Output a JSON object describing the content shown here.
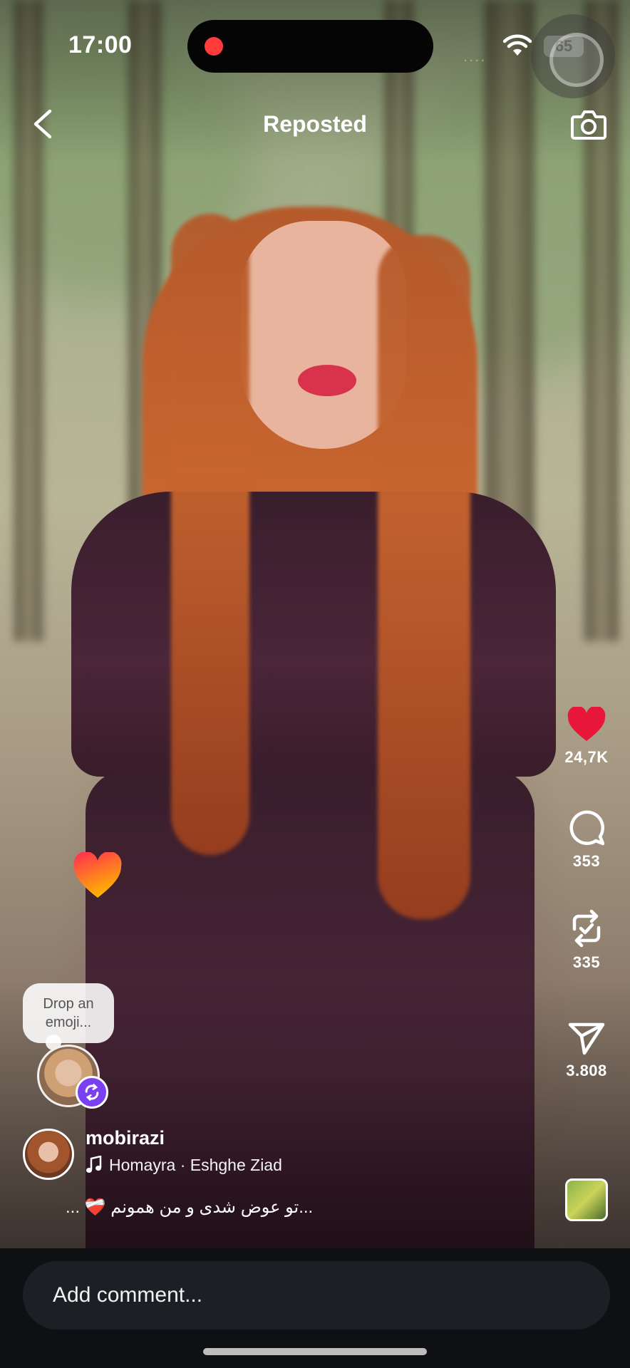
{
  "status_bar": {
    "time": "17:00",
    "battery_level": "65",
    "signal": "....",
    "wifi_icon": "wifi-icon",
    "recording_indicator_color": "#ff3b3b"
  },
  "header": {
    "title": "Reposted",
    "back_icon": "chevron-left-icon",
    "camera_icon": "camera-icon"
  },
  "actions": {
    "like": {
      "icon": "heart-icon",
      "count": "24,7K",
      "active": true,
      "color": "#e8173a"
    },
    "comment": {
      "icon": "comment-icon",
      "count": "353"
    },
    "repost": {
      "icon": "repost-icon",
      "count": "335"
    },
    "share": {
      "icon": "send-icon",
      "count": "3.808"
    },
    "more": {
      "icon": "more-icon",
      "label": "..."
    }
  },
  "emoji_prompt": {
    "line1": "Drop an",
    "line2": "emoji..."
  },
  "post": {
    "author": "mobirazi",
    "music": "Homayra · Eshghe Ziad",
    "caption": "... ❤️‍🩹 تو عوض شدی و من همونم..."
  },
  "comment_box": {
    "placeholder": "Add comment..."
  },
  "colors": {
    "repost_badge": "#7b3ff2",
    "bottom_bar": "#0e1013",
    "input_bg": "#1c1f24"
  }
}
